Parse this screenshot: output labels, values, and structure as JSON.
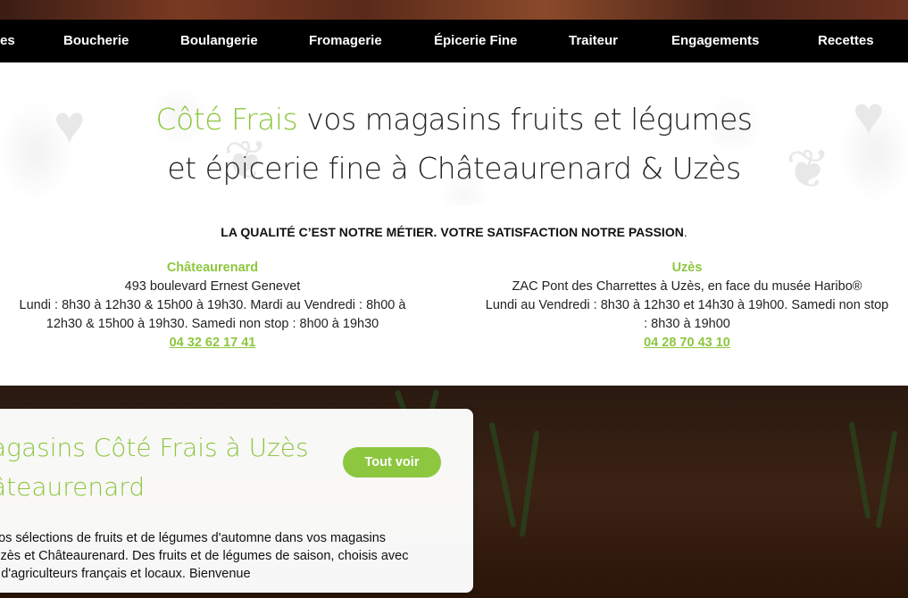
{
  "nav": {
    "items": [
      "es",
      "Boucherie",
      "Boulangerie",
      "Fromagerie",
      "Épicerie Fine",
      "Traiteur",
      "Engagements",
      "Recettes"
    ]
  },
  "hero": {
    "brand": "Côté Frais",
    "line1_rest": " vos magasins fruits et légumes",
    "line2": "et épicerie fine à Châteaurenard & Uzès"
  },
  "tagline": {
    "bold": "LA QUALITÉ C’EST NOTRE MÉTIER. VOTRE SATISFACTION NOTRE PASSION",
    "end": "."
  },
  "stores": [
    {
      "name": "Châteaurenard",
      "address": "493 boulevard Ernest Genevet",
      "hours_line1": "Lundi : 8h30 à 12h30 & 15h00 à 19h30. Mardi au Vendredi : 8h00 à",
      "hours_line2": "12h30 & 15h00 à 19h30. Samedi non stop : 8h00 à 19h30",
      "phone": "04 32 62 17 41"
    },
    {
      "name": "Uzès",
      "address": "ZAC Pont des Charrettes à Uzès, en face du musée Haribo®",
      "hours_line1": "Lundi au Vendredi : 8h30 à 12h30 et 14h30 à 19h00. Samedi non stop",
      "hours_line2": ": 8h30 à 19h00",
      "phone": "04 28 70 43 10"
    }
  ],
  "promo": {
    "title_line1": "agasins Côté Frais à Uzès",
    "title_line2": "âteaurenard",
    "button": "Tout voir",
    "text_line1": "nos sélections de fruits et de légumes d'automne dans vos magasins",
    "text_line2": "Uzès et Châteaurenard. Des fruits et de légumes de saison, choisis avec",
    "text_line3": "s d'agriculteurs français et locaux. Bienvenue"
  },
  "colors": {
    "accent": "#8dc63f",
    "nav_bg": "#000000"
  }
}
